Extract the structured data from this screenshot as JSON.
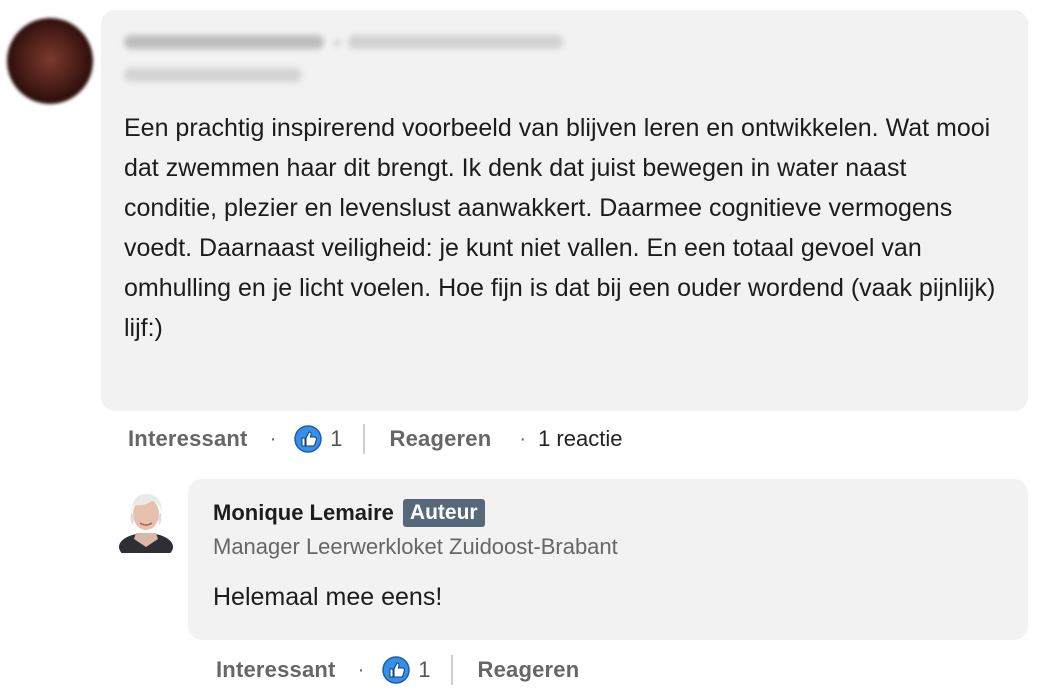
{
  "comment": {
    "text": "Een prachtig inspirerend voorbeeld van blijven leren en ontwikkelen. Wat mooi dat zwemmen haar dit brengt. Ik denk dat juist bewegen in water naast conditie, plezier en levenslust aanwakkert. Daarmee cognitieve vermogens voedt. Daarnaast veiligheid: je kunt niet vallen. En een totaal gevoel van omhulling en je licht voelen. Hoe fijn is dat bij een ouder wordend (vaak pijnlijk) lijf:)",
    "actions": {
      "like_label": "Interessant",
      "separator": "·",
      "reaction_count": "1",
      "reply_label": "Reageren",
      "reply_count": "1 reactie"
    }
  },
  "reply": {
    "author_name": "Monique Lemaire",
    "author_badge": "Auteur",
    "author_headline": "Manager Leerwerkloket Zuidoost-Brabant",
    "text": "Helemaal mee eens!",
    "actions": {
      "like_label": "Interessant",
      "separator": "·",
      "reaction_count": "1",
      "reply_label": "Reageren"
    }
  },
  "icons": {
    "reaction": "like-thumb-icon",
    "reaction_color": "#378fe9"
  }
}
